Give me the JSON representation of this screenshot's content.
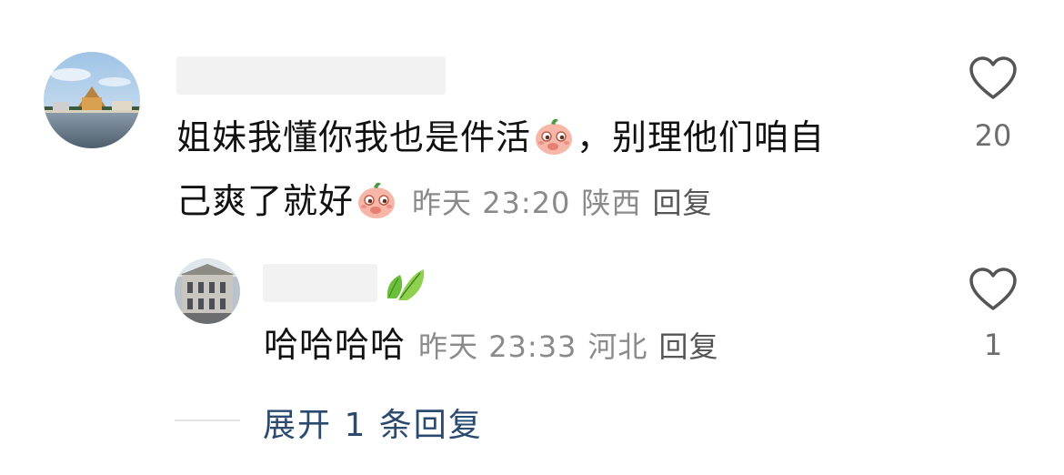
{
  "comment": {
    "text_part1": "姐妹我懂你我也是件活",
    "text_part2": "，别理他们咱自",
    "text_part3": "己爽了就好",
    "emoji_icon": "peach-shy-emoji-icon",
    "time": "昨天 23:20",
    "location": "陕西",
    "reply_label": "回复",
    "like_count": "20"
  },
  "reply": {
    "badge_icon": "leaf-badge-icon",
    "text": "哈哈哈哈",
    "time": "昨天 23:33",
    "location": "河北",
    "reply_label": "回复",
    "like_count": "1"
  },
  "expand_label": "展开 1 条回复",
  "colors": {
    "expand_link": "#2b4a6f",
    "meta": "#8a8a8a",
    "heart_outline": "#555555"
  }
}
